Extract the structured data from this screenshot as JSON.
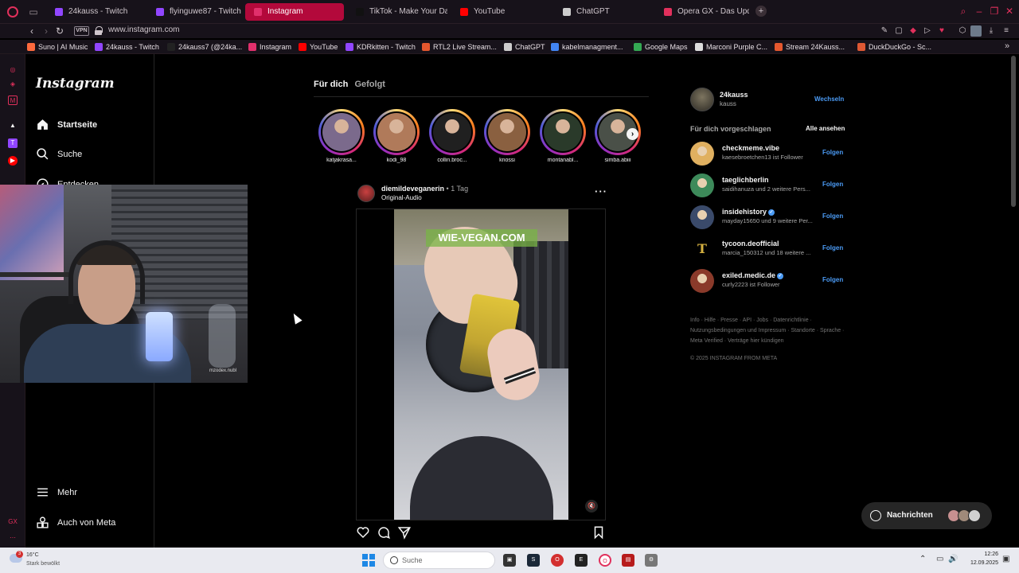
{
  "browser": {
    "tabs": [
      {
        "label": "24kauss - Twitch",
        "color": "#9146ff",
        "x": 0
      },
      {
        "label": "flyinguwe87 - Twitch",
        "color": "#9146ff"
      },
      {
        "label": "Instagram",
        "color": "#e1306c",
        "active": true
      },
      {
        "label": "TikTok - Make Your Day",
        "color": "#111111"
      },
      {
        "label": "YouTube",
        "color": "#ff0000"
      },
      {
        "label": "ChatGPT",
        "color": "#cccccc"
      },
      {
        "label": "Opera GX - Das Update is...",
        "color": "#e1305c"
      }
    ],
    "url": "www.instagram.com",
    "vpn_label": "VPN",
    "bookmarks": [
      {
        "label": "Suno | AI Music",
        "color": "#ff6a3d"
      },
      {
        "label": "24kauss - Twitch",
        "color": "#9146ff"
      },
      {
        "label": "24kauss7 (@24ka...",
        "color": "#222222"
      },
      {
        "label": "Instagram",
        "color": "#e1306c"
      },
      {
        "label": "YouTube",
        "color": "#ff0000"
      },
      {
        "label": "KDRkitten - Twitch",
        "color": "#9146ff"
      },
      {
        "label": "RTL2 Live Stream...",
        "color": "#e4572e"
      },
      {
        "label": "ChatGPT",
        "color": "#cccccc"
      },
      {
        "label": "kabelmanagment...",
        "color": "#4285f4"
      },
      {
        "label": "Google Maps",
        "color": "#34a853"
      },
      {
        "label": "Marconi Purple C...",
        "color": "#dddddd"
      },
      {
        "label": "Stream 24Kauss...",
        "color": "#e4572e"
      },
      {
        "label": "DuckDuckGo - Sc...",
        "color": "#de5833"
      }
    ]
  },
  "nav": {
    "logo": "Instagram",
    "items": [
      {
        "label": "Startseite",
        "icon": "home-icon"
      },
      {
        "label": "Suche",
        "icon": "search-icon"
      },
      {
        "label": "Entdecken",
        "icon": "compass-icon"
      }
    ],
    "more": "Mehr",
    "meta": "Auch von Meta"
  },
  "webcam": {
    "watermark": "mzodex.nubl"
  },
  "feed": {
    "tabs": [
      "Für dich",
      "Gefolgt"
    ],
    "stories": [
      {
        "name": "katjakrasa...",
        "color": "#7b6a8c"
      },
      {
        "name": "kodi_98",
        "color": "#b07a5a"
      },
      {
        "name": "collin.broc...",
        "color": "#202020"
      },
      {
        "name": "knossi",
        "color": "#8a6040"
      },
      {
        "name": "montanabl...",
        "color": "#2a3a2a"
      },
      {
        "name": "simba.abiii",
        "color": "#4a5048"
      }
    ],
    "post": {
      "user": "diemildeveganerin",
      "separator": "•",
      "age": "1 Tag",
      "audio": "Original-Audio",
      "watermark": "WIE-VEGAN.COM"
    }
  },
  "sidebar": {
    "me": {
      "username": "24kauss",
      "name": "kauss",
      "switch": "Wechseln"
    },
    "suggested_title": "Für dich vorgeschlagen",
    "see_all": "Alle ansehen",
    "suggestions": [
      {
        "user": "checkmeme.vibe",
        "sub": "kaesebroetchen13 ist Follower",
        "follow": "Folgen",
        "color": "#e0b060",
        "verified": false
      },
      {
        "user": "taeglichberlin",
        "sub": "saidihanuza und 2 weitere Pers...",
        "follow": "Folgen",
        "color": "#3d8a5a",
        "verified": false
      },
      {
        "user": "insidehistory",
        "sub": "mayday15650 und 9 weitere Per...",
        "follow": "Folgen",
        "color": "#3a4a6a",
        "verified": true
      },
      {
        "user": "tycoon.deofficial",
        "sub": "marcia_150312 und 18 weitere ...",
        "follow": "Folgen",
        "color": "#000000",
        "verified": false,
        "glyph": "T"
      },
      {
        "user": "exiled.medic.de",
        "sub": "curly2223 ist Follower",
        "follow": "Folgen",
        "color": "#8a3a2a",
        "verified": true
      }
    ],
    "footer_links": "Info · Hilfe · Presse · API · Jobs · Datenrichtlinie · Nutzungsbedingungen und Impressum · Standorte · Sprache · Meta Verified · Verträge hier kündigen",
    "copyright": "© 2025 INSTAGRAM FROM META"
  },
  "messages": {
    "label": "Nachrichten"
  },
  "taskbar": {
    "temp": "16°C",
    "weather": "Stark bewölkt",
    "badge": "3",
    "search": "Suche",
    "time": "12:26",
    "date": "12.09.2025"
  },
  "colors": {
    "accent": "#b3093b",
    "link": "#4b9bf5",
    "bg": "#000000"
  }
}
